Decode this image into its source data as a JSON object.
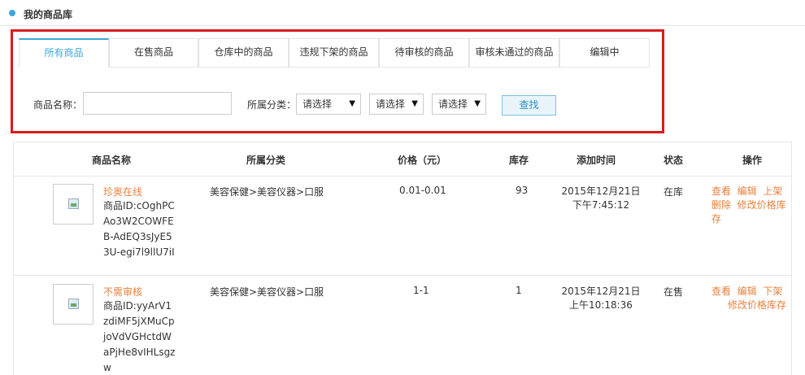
{
  "header": {
    "title": "我的商品库"
  },
  "tabs": [
    {
      "label": "所有商品"
    },
    {
      "label": "在售商品"
    },
    {
      "label": "仓库中的商品"
    },
    {
      "label": "违规下架的商品"
    },
    {
      "label": "待审核的商品"
    },
    {
      "label": "审核未通过的商品"
    },
    {
      "label": "编辑中"
    }
  ],
  "active_tab": 0,
  "search": {
    "name_label": "商品名称：",
    "name_value": "",
    "category_label": "所属分类：",
    "selects": [
      {
        "value": "请选择"
      },
      {
        "value": "请选择"
      },
      {
        "value": "请选择"
      }
    ],
    "caret": "▼",
    "button": "查找"
  },
  "table": {
    "columns": [
      "商品名称",
      "所属分类",
      "价格（元）",
      "库存",
      "添加时间",
      "状态",
      "操作"
    ],
    "rows": [
      {
        "name": "珍奥在线",
        "id": "商品ID:cOghPCAo3W2COWFEB-AdEQ3sJyE53U-egi7l9llU7iI",
        "category": "美容保健>美容仪器>口服",
        "price": "0.01-0.01",
        "stock": "93",
        "date": "2015年12月21日",
        "time": "下午7:45:12",
        "status": "在库",
        "ops": [
          "查看",
          "编辑",
          "上架",
          "删除",
          "修改价格库存"
        ]
      },
      {
        "name": "不需审核",
        "id": "商品ID:yyArV1zdiMF5jXMuCpjoVdVGHctdWaPjHe8vIHLsgzw",
        "category": "美容保健>美容仪器>口服",
        "price": "1-1",
        "stock": "1",
        "date": "2015年12月21日",
        "time": "上午10:18:36",
        "status": "在售",
        "ops": [
          "查看",
          "编辑",
          "下架",
          "修改价格库存"
        ]
      }
    ]
  }
}
